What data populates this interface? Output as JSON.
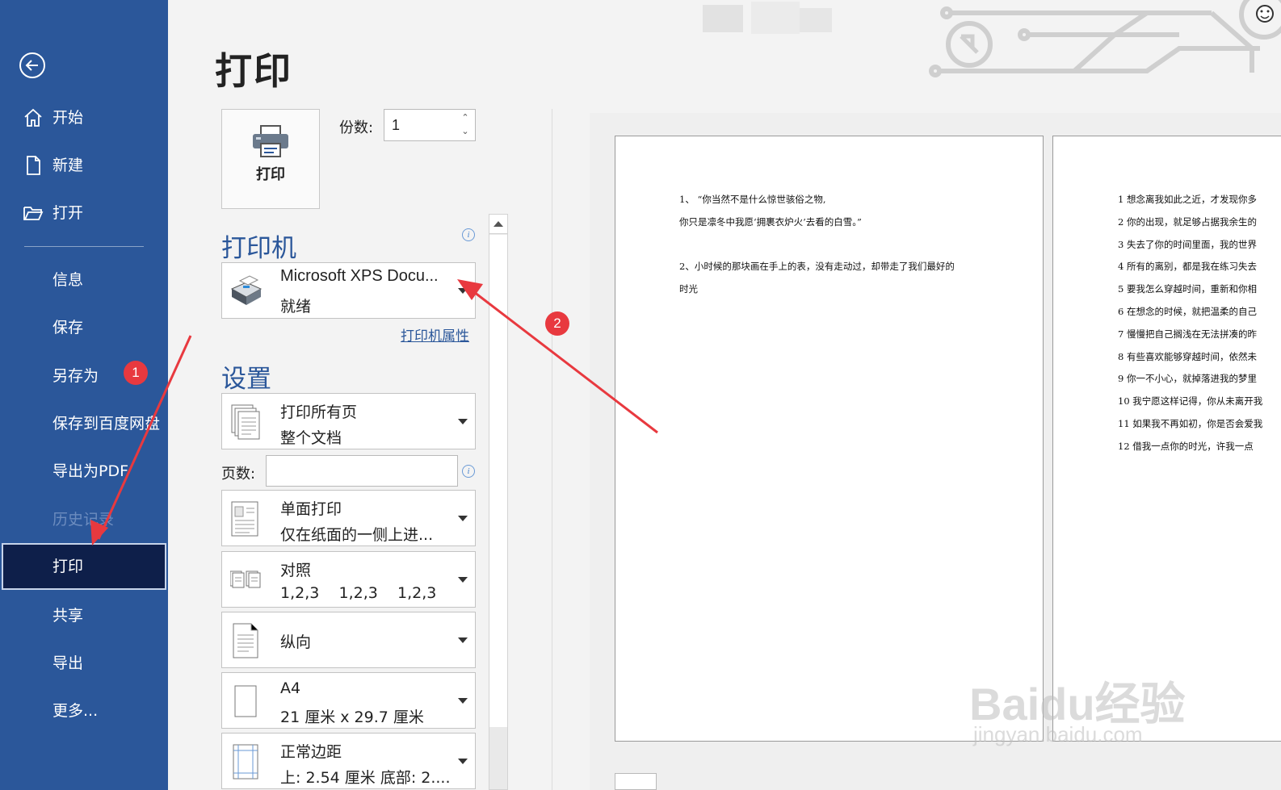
{
  "nav": {
    "top_items": [
      {
        "label": "开始",
        "icon": "home-icon"
      },
      {
        "label": "新建",
        "icon": "new-document-icon"
      },
      {
        "label": "打开",
        "icon": "open-folder-icon"
      }
    ],
    "items": [
      {
        "label": "信息"
      },
      {
        "label": "保存"
      },
      {
        "label": "另存为"
      },
      {
        "label": "保存到百度网盘"
      },
      {
        "label": "导出为PDF"
      },
      {
        "label": "历史记录",
        "disabled": true
      },
      {
        "label": "打印",
        "active": true
      },
      {
        "label": "共享"
      },
      {
        "label": "导出"
      },
      {
        "label": "更多..."
      }
    ]
  },
  "page_title": "打印",
  "print_button": {
    "label": "打印",
    "icon": "printer-icon"
  },
  "copies": {
    "label": "份数:",
    "value": "1"
  },
  "printer_section": {
    "heading": "打印机",
    "name": "Microsoft XPS Docu...",
    "status": "就绪",
    "properties_link": "打印机属性"
  },
  "settings_section": {
    "heading": "设置",
    "pages_label": "页数:",
    "pages_value": "",
    "options": [
      {
        "l1": "打印所有页",
        "l2": "整个文档",
        "icon": "all-pages-icon"
      },
      {
        "l1": "单面打印",
        "l2": "仅在纸面的一侧上进...",
        "icon": "one-sided-icon"
      },
      {
        "l1": "对照",
        "l2": "1,2,3    1,2,3    1,2,3",
        "icon": "collated-icon"
      },
      {
        "l1": "纵向",
        "l2": "",
        "icon": "portrait-icon"
      },
      {
        "l1": "A4",
        "l2": "21 厘米 x 29.7 厘米",
        "icon": "paper-size-icon"
      },
      {
        "l1": "正常边距",
        "l2": "上: 2.54 厘米 底部: 2....",
        "icon": "margins-icon"
      }
    ]
  },
  "preview": {
    "page1": [
      "1、 “你当然不是什么惊世骇俗之物,",
      "你只是凛冬中我愿‘拥裹衣炉火’去看的白雪。”",
      "",
      "2、小时候的那块画在手上的表，没有走动过，却带走了我们最好的",
      "时光"
    ],
    "page2": [
      "1 想念离我如此之近，才发现你多",
      "2 你的出现，就足够占据我余生的",
      "3 失去了你的时间里面，我的世界",
      "4 所有的离别，都是我在练习失去",
      "5 要我怎么穿越时间，重新和你相",
      "6 在想念的时候，就把温柔的自己",
      "7 慢慢把自己搁浅在无法拼凑的昨",
      "8 有些喜欢能够穿越时间，依然未",
      "9 你一不小心，就掉落进我的梦里",
      "10 我宁愿这样记得，你从未离开我",
      "11 如果我不再如初，你是否会爱我",
      "12 借我一点你的时光，许我一点"
    ]
  },
  "annotations": {
    "badge1": "1",
    "badge2": "2",
    "color": "#e8393f"
  },
  "watermark": {
    "logo": "Baidu经验",
    "url": "jingyan.baidu.com"
  }
}
